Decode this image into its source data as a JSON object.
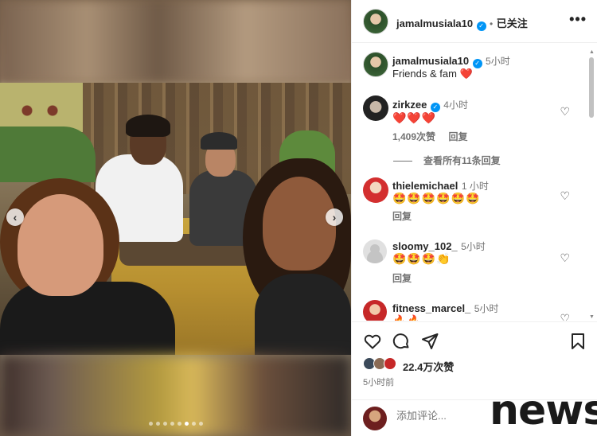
{
  "header": {
    "username": "jamalmusiala10",
    "separator": "•",
    "follow_status": "已关注",
    "more_label": "•••"
  },
  "caption": {
    "username": "jamalmusiala10",
    "time": "5小时",
    "text": "Friends & fam ❤️"
  },
  "comments": [
    {
      "username": "zirkzee",
      "verified": true,
      "time": "4小时",
      "text": "❤️❤️❤️",
      "likes": "1,409次赞",
      "reply": "回复"
    },
    {
      "username": "thielemichael",
      "verified": false,
      "time": "1 小时",
      "text": "🤩🤩🤩🤩🤩🤩",
      "reply": "回复"
    },
    {
      "username": "sloomy_102_",
      "verified": false,
      "time": "5小时",
      "text": "🤩🤩🤩👏",
      "reply": "回复"
    },
    {
      "username": "fitness_marcel_",
      "verified": false,
      "time": "5小时",
      "text": "🔥🔥"
    }
  ],
  "view_replies": "查看所有11条回复",
  "actions": {
    "likes": "22.4万次赞",
    "posted": "5小时前"
  },
  "add_comment": {
    "placeholder": "添加评论..."
  },
  "watermark": "news",
  "colors": {
    "verified": "#0095f6",
    "heart": "#ed4956",
    "text": "#262626",
    "muted": "#737373"
  }
}
